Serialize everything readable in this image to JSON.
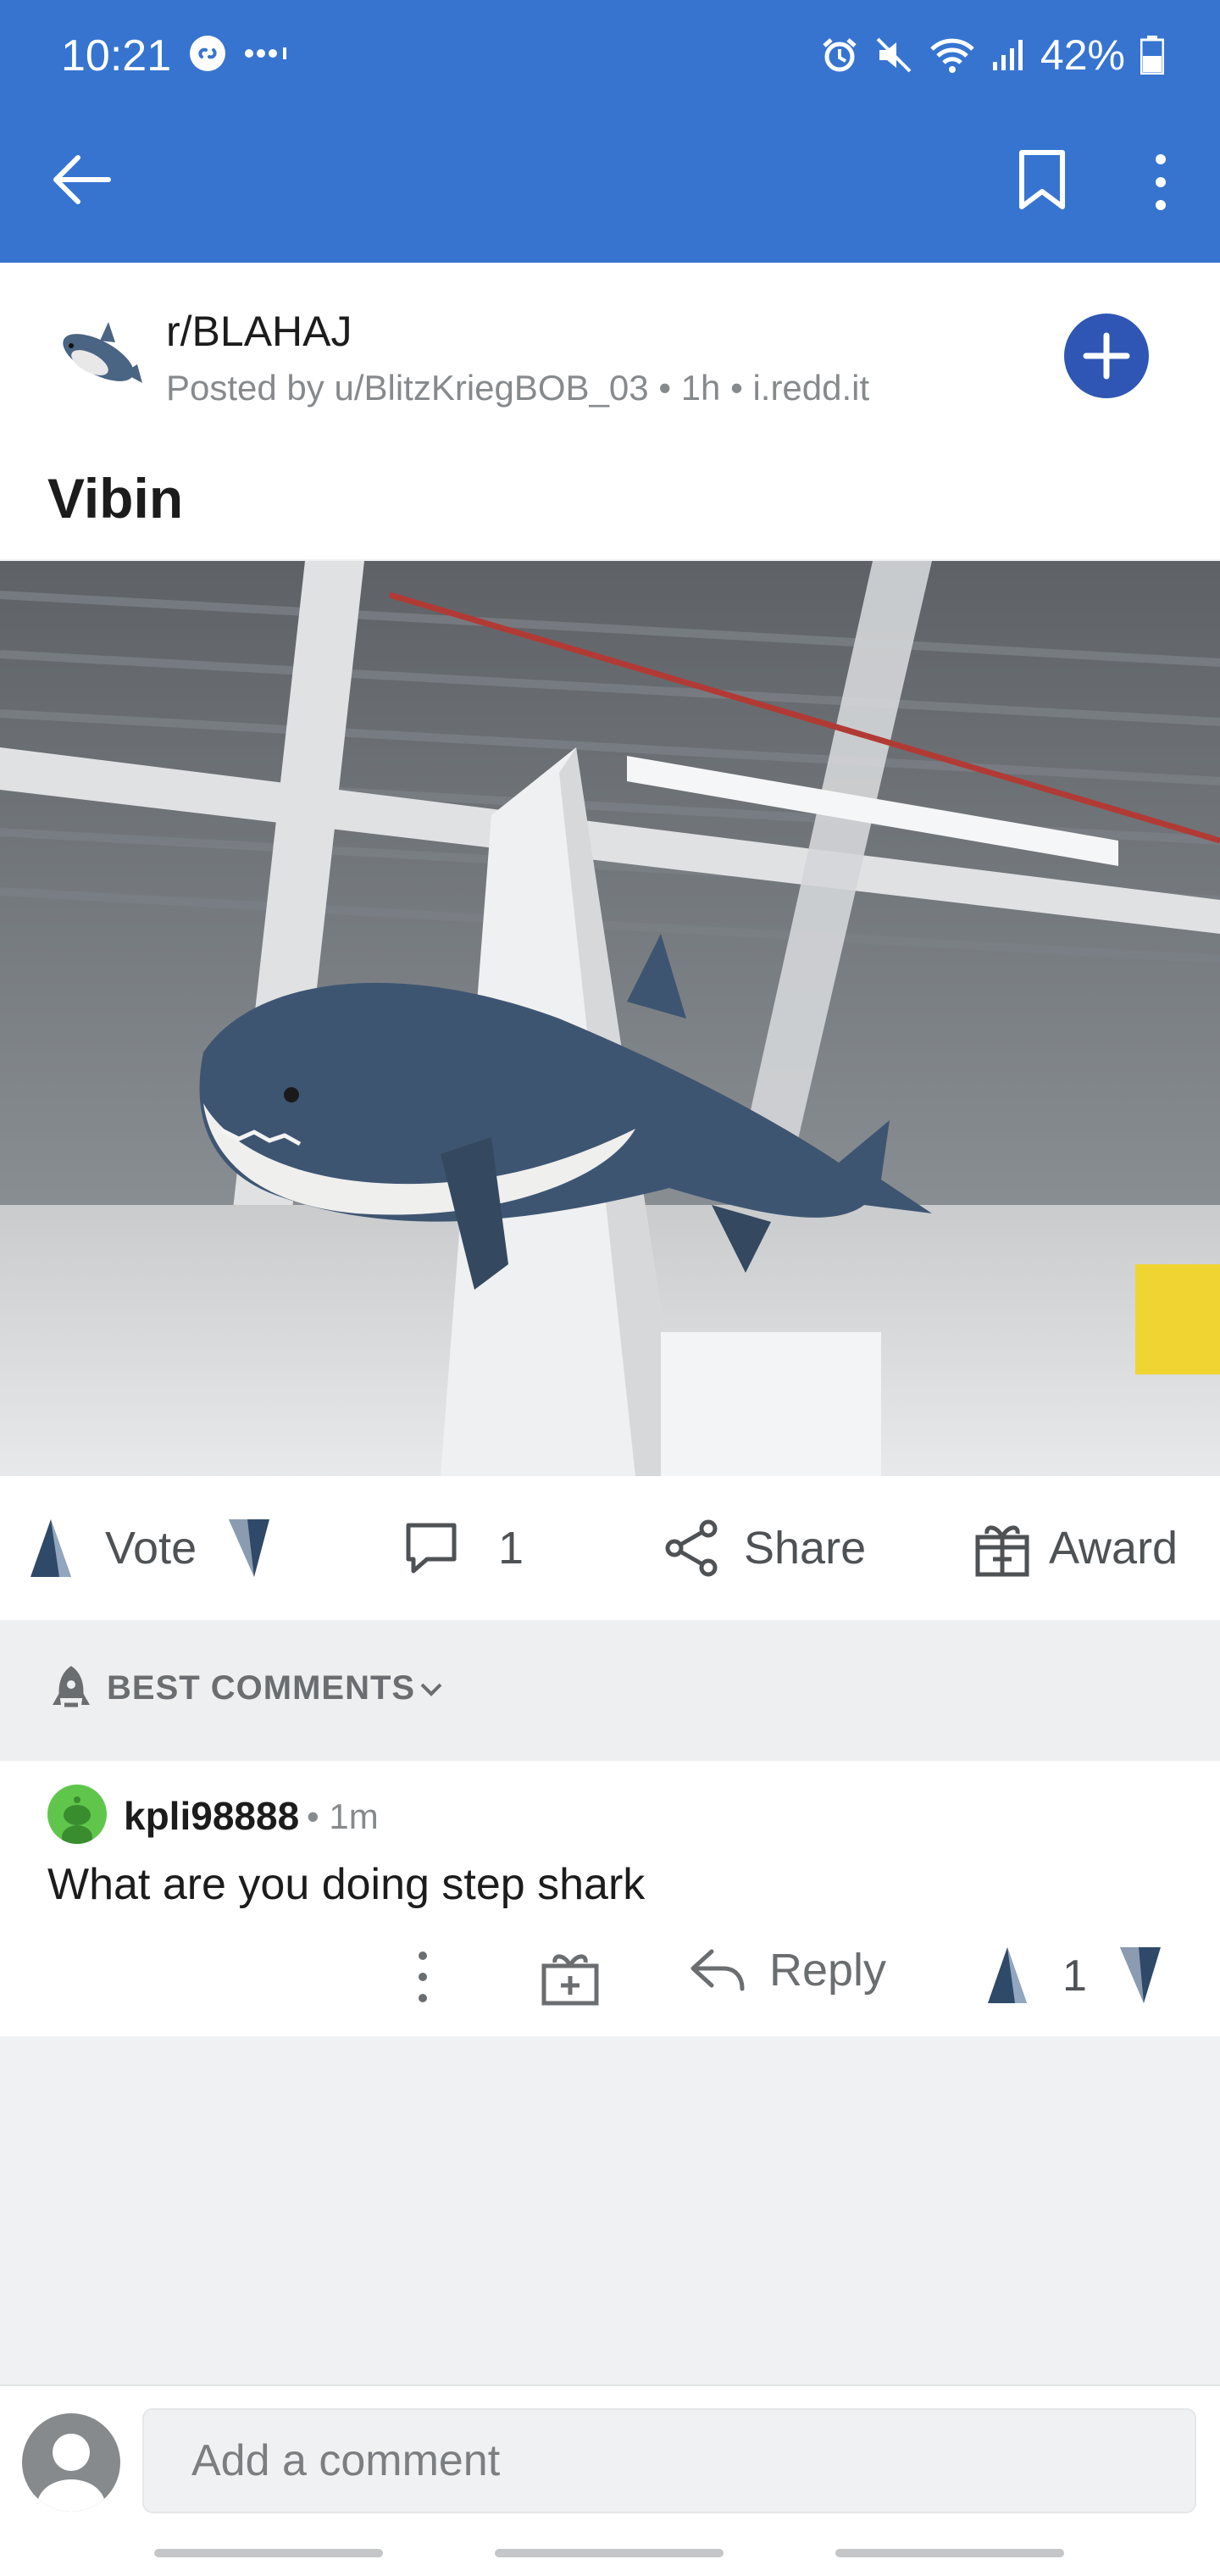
{
  "status_bar": {
    "time": "10:21",
    "battery": "42%"
  },
  "toolbar": {
    "back_icon": "arrow-left-icon",
    "bookmark_icon": "bookmark-icon",
    "more_icon": "more-vertical-icon"
  },
  "post": {
    "subreddit": "r/BLAHAJ",
    "posted_by": "Posted by u/BlitzKriegBOB_03 • 1h • i.redd.it",
    "title": "Vibin",
    "join_icon": "plus-icon"
  },
  "actions": {
    "vote_label": "Vote",
    "comment_count": "1",
    "share_label": "Share",
    "award_label": "Award"
  },
  "sort": {
    "label": "BEST COMMENTS"
  },
  "comments": [
    {
      "user": "kpli98888",
      "time": "• 1m",
      "body": "What are you doing step shark",
      "reply_label": "Reply",
      "score": "1"
    }
  ],
  "composer": {
    "placeholder": "Add a comment"
  },
  "colors": {
    "header": "#3674d0",
    "join": "#2f56b4",
    "avatar_green": "#5fc64b"
  }
}
